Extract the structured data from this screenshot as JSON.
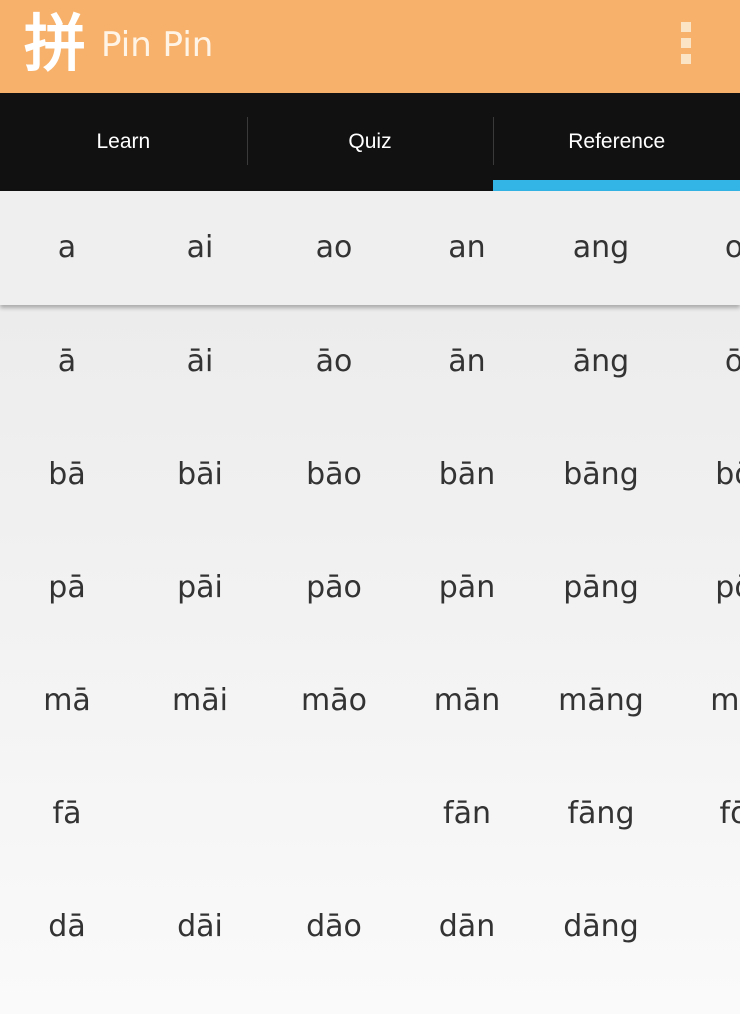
{
  "app_bar": {
    "logo_char": "拼",
    "title": "Pin Pin",
    "background": "#f7b16b",
    "menu_icon": "overflow-menu-icon"
  },
  "tabs": [
    {
      "label": "Learn",
      "active": false
    },
    {
      "label": "Quiz",
      "active": false
    },
    {
      "label": "Reference",
      "active": true
    }
  ],
  "accent_color": "#33b5e5",
  "table": {
    "header_row": [
      "a",
      "ai",
      "ao",
      "an",
      "ang",
      "o"
    ],
    "rows": [
      [
        "ā",
        "āi",
        "āo",
        "ān",
        "āng",
        "ō"
      ],
      [
        "bā",
        "bāi",
        "bāo",
        "bān",
        "bāng",
        "bō"
      ],
      [
        "pā",
        "pāi",
        "pāo",
        "pān",
        "pāng",
        "pō"
      ],
      [
        "mā",
        "māi",
        "māo",
        "mān",
        "māng",
        "mō"
      ],
      [
        "fā",
        "",
        "",
        "fān",
        "fāng",
        "fō"
      ],
      [
        "dā",
        "dāi",
        "dāo",
        "dān",
        "dāng",
        ""
      ]
    ]
  }
}
